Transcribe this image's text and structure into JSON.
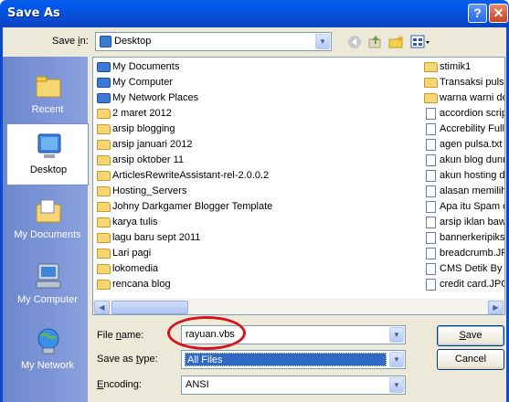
{
  "window": {
    "title": "Save As",
    "help": "?",
    "close": "✕"
  },
  "toolbar": {
    "save_in_label": "Save in:",
    "save_in_value": "Desktop",
    "back_icon": "back-icon",
    "up_icon": "up-folder-icon",
    "new_folder_icon": "new-folder-icon",
    "views_icon": "views-menu-icon"
  },
  "places": [
    {
      "label": "Recent",
      "icon": "recent-icon"
    },
    {
      "label": "Desktop",
      "icon": "desktop-icon"
    },
    {
      "label": "My Documents",
      "icon": "my-documents-icon"
    },
    {
      "label": "My Computer",
      "icon": "my-computer-icon"
    },
    {
      "label": "My Network",
      "icon": "my-network-icon"
    }
  ],
  "files": {
    "col1": [
      {
        "name": "My Documents",
        "type": "special"
      },
      {
        "name": "My Computer",
        "type": "special"
      },
      {
        "name": "My Network Places",
        "type": "special"
      },
      {
        "name": "2 maret 2012",
        "type": "folder"
      },
      {
        "name": "arsip blogging",
        "type": "folder"
      },
      {
        "name": "arsip januari 2012",
        "type": "folder"
      },
      {
        "name": "arsip oktober 11",
        "type": "folder"
      },
      {
        "name": "ArticlesRewriteAssistant-rel-2.0.0.2",
        "type": "folder"
      },
      {
        "name": "Hosting_Servers",
        "type": "folder"
      },
      {
        "name": "Johny Darkgamer Blogger Template",
        "type": "folder"
      },
      {
        "name": "karya tulis",
        "type": "folder"
      },
      {
        "name": "lagu baru sept 2011",
        "type": "folder"
      },
      {
        "name": "Lari pagi",
        "type": "folder"
      },
      {
        "name": "lokomedia",
        "type": "folder"
      },
      {
        "name": "rencana blog",
        "type": "folder"
      }
    ],
    "col2": [
      {
        "name": "stimik1",
        "type": "folder"
      },
      {
        "name": "Transaksi pulsa",
        "type": "folder"
      },
      {
        "name": "warna warni de",
        "type": "folder"
      },
      {
        "name": "accordion scrip",
        "type": "doc"
      },
      {
        "name": "Accrebility Full",
        "type": "doc"
      },
      {
        "name": "agen pulsa.txt",
        "type": "doc"
      },
      {
        "name": "akun blog dunn",
        "type": "doc"
      },
      {
        "name": "akun hosting d",
        "type": "doc"
      },
      {
        "name": "alasan memilih",
        "type": "doc"
      },
      {
        "name": "Apa itu Spam c",
        "type": "doc"
      },
      {
        "name": "arsip iklan baw",
        "type": "doc"
      },
      {
        "name": "bannerkeripiks",
        "type": "doc"
      },
      {
        "name": "breadcrumb.JP",
        "type": "doc"
      },
      {
        "name": "CMS Detik By S",
        "type": "doc"
      },
      {
        "name": "credit card.JPG",
        "type": "doc"
      }
    ]
  },
  "form": {
    "filename_label_pre": "File ",
    "filename_label_u": "n",
    "filename_label_post": "ame:",
    "filename_value": "rayuan.vbs",
    "savetype_label_pre": "Save as ",
    "savetype_label_u": "t",
    "savetype_label_post": "ype:",
    "savetype_value": "All Files",
    "encoding_label_u": "E",
    "encoding_label_post": "ncoding:",
    "encoding_value": "ANSI"
  },
  "buttons": {
    "save_u": "S",
    "save_post": "ave",
    "cancel": "Cancel"
  },
  "colors": {
    "title_blue": "#0a4fd6",
    "places_blue": "#7b93d6",
    "annotation_red": "#d4141b",
    "selection": "#316ac5"
  }
}
